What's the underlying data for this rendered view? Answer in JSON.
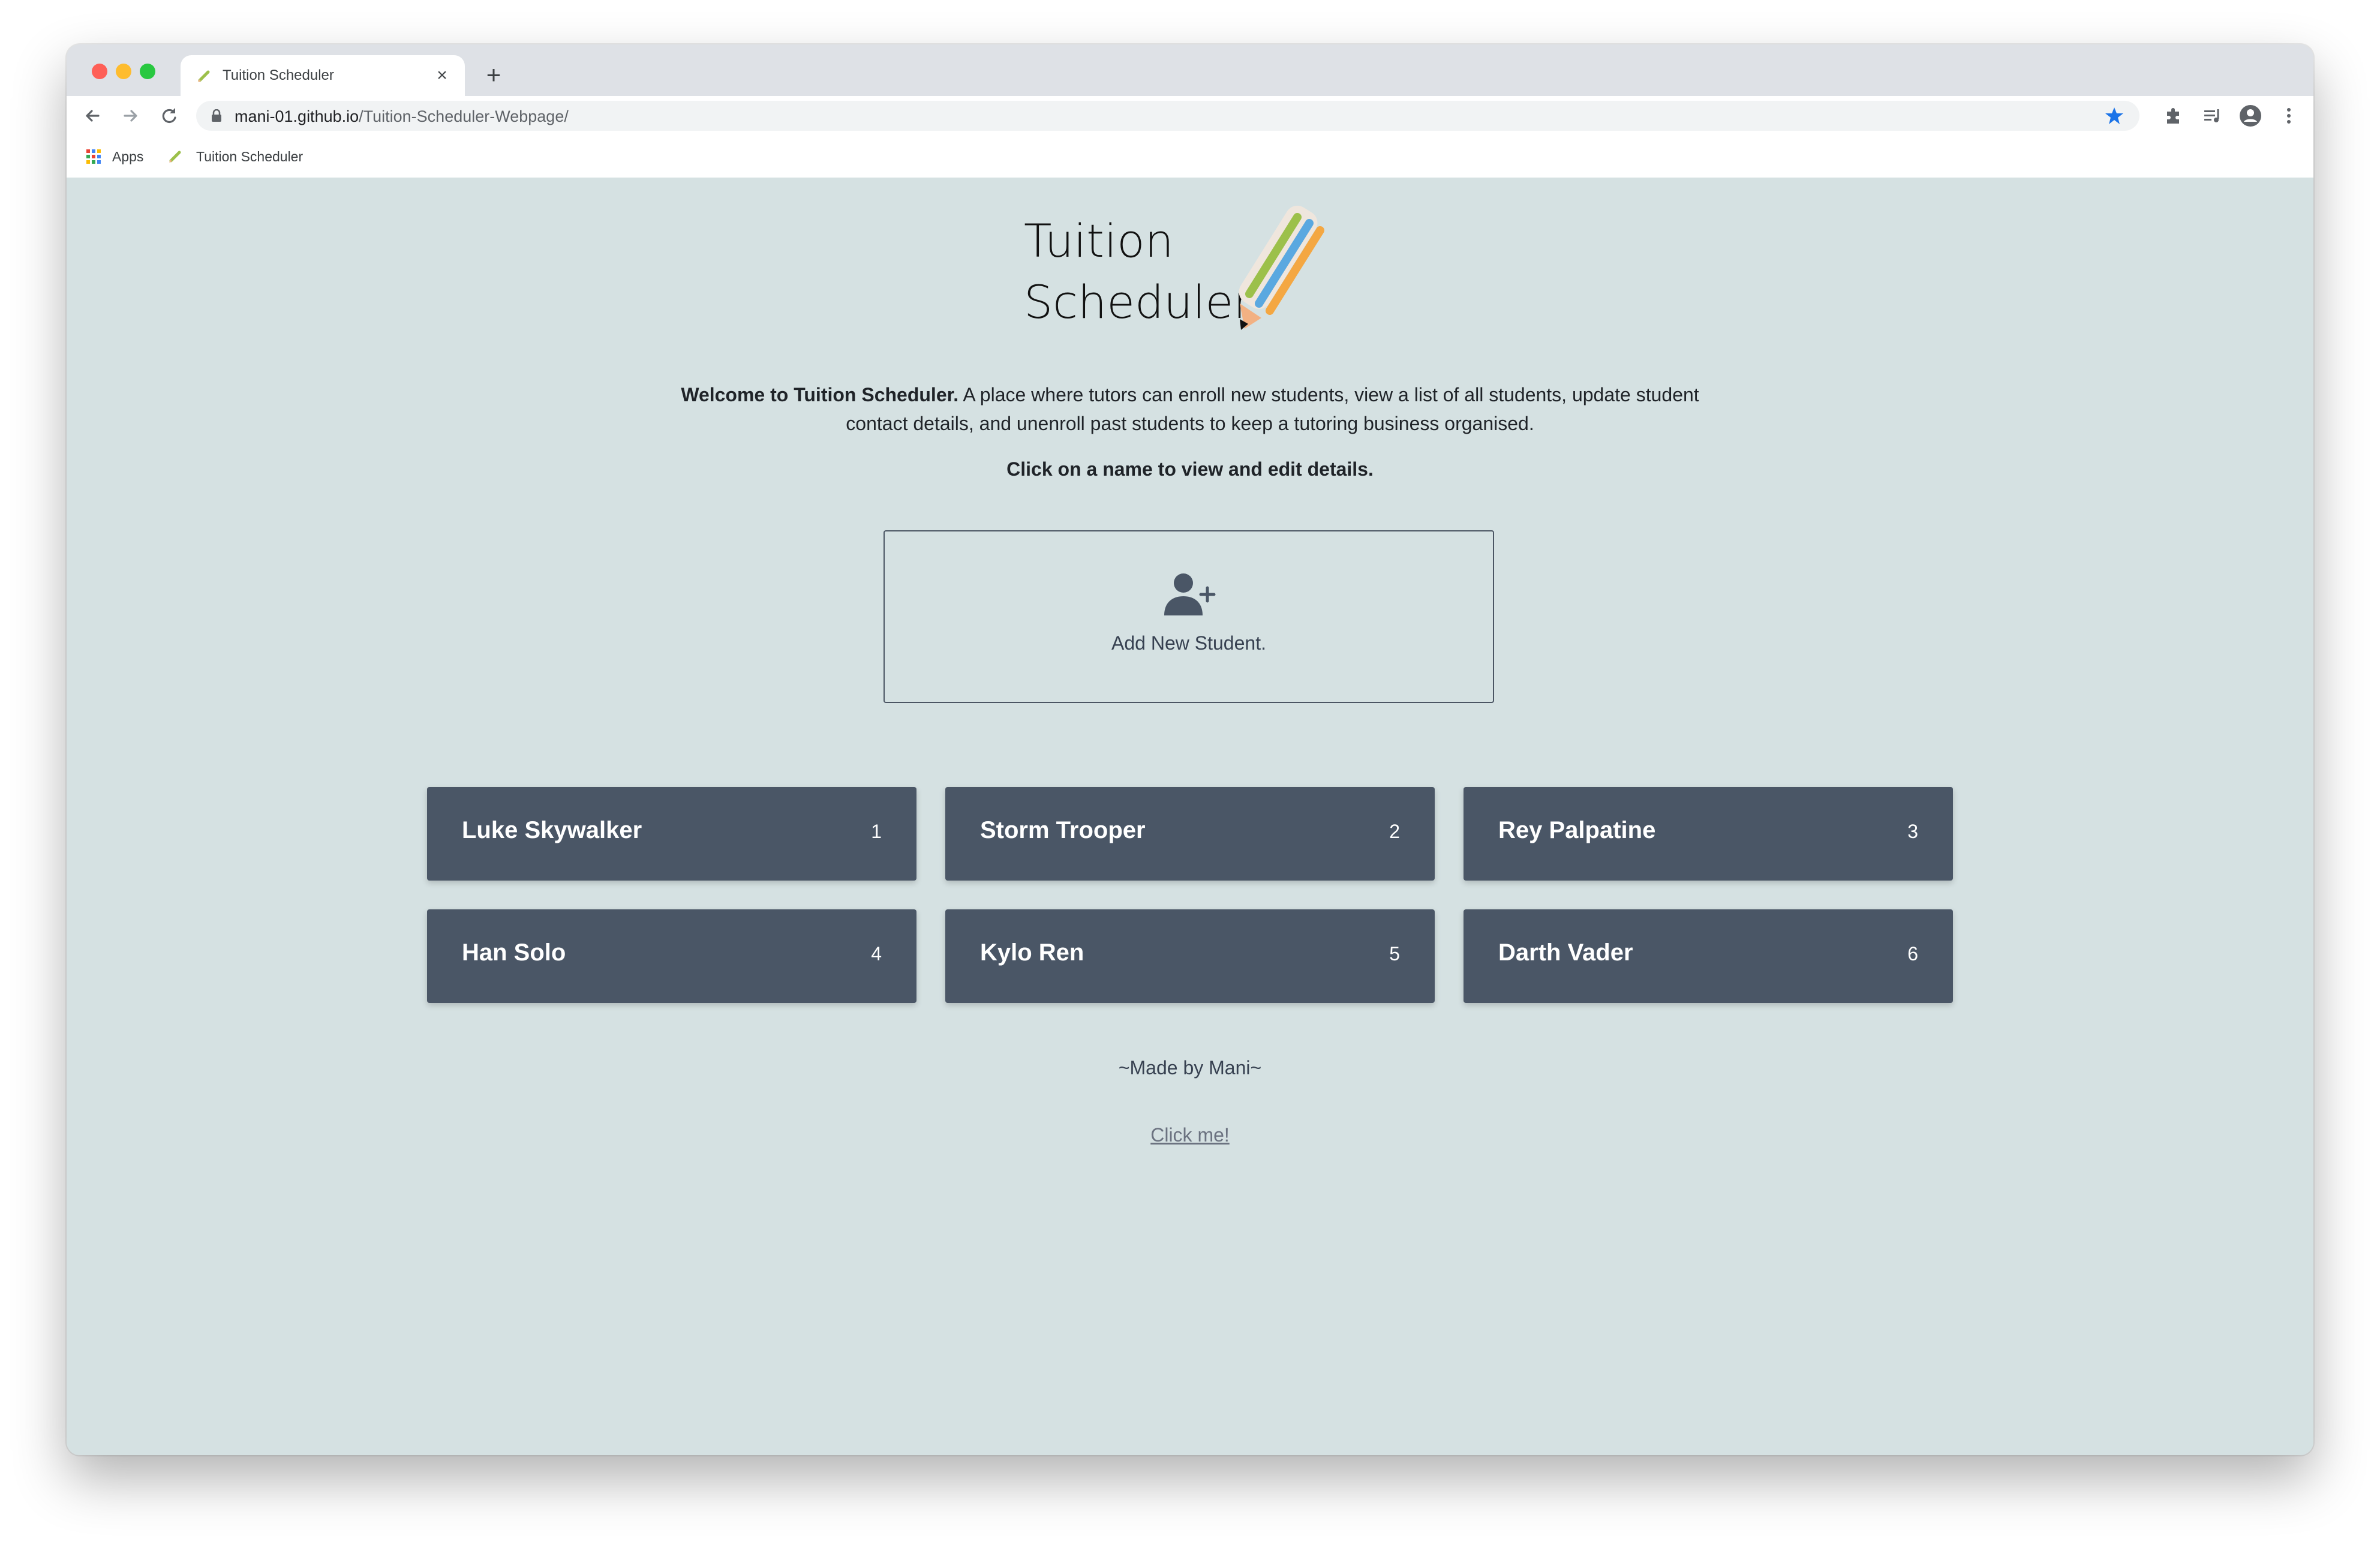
{
  "browser": {
    "tab_title": "Tuition Scheduler",
    "tab_close": "×",
    "new_tab": "+",
    "url_domain": "mani-01.github.io",
    "url_path": "/Tuition-Scheduler-Webpage/",
    "bookmarks": [
      "Apps",
      "Tuition Scheduler"
    ],
    "accent_color": "#1a73e8"
  },
  "page": {
    "logo_text": [
      "Tuition",
      "Scheduler"
    ],
    "intro_bold": "Welcome to Tuition Scheduler.",
    "intro_rest": " A place where tutors can enroll new students, view a list of all students, update student contact details, and unenroll past students to keep a tutoring business organised.",
    "instruction": "Click on a name to view and edit details.",
    "add_student_label": "Add New Student.",
    "add_student_icon": "add-user-icon",
    "students": [
      {
        "name": "Luke Skywalker",
        "id": "1"
      },
      {
        "name": "Storm Trooper",
        "id": "2"
      },
      {
        "name": "Rey Palpatine",
        "id": "3"
      },
      {
        "name": "Han Solo",
        "id": "4"
      },
      {
        "name": "Kylo Ren",
        "id": "5"
      },
      {
        "name": "Darth Vader",
        "id": "6"
      }
    ],
    "footer_made": "~Made by Mani~",
    "footer_link": "Click me!",
    "card_color": "#4a5666",
    "background_color": "#d5e1e2"
  }
}
